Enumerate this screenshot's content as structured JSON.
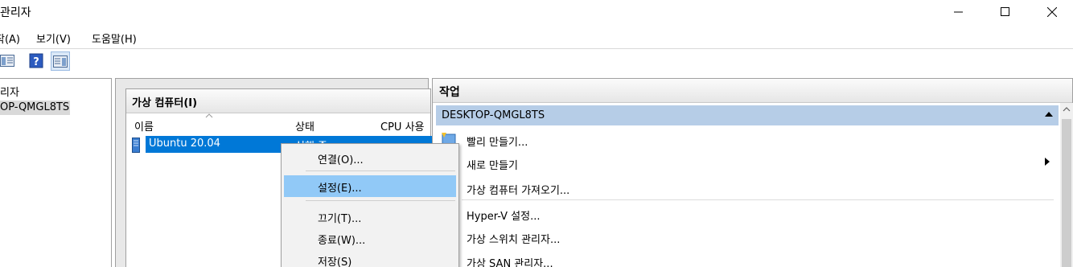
{
  "window": {
    "title": "관리자"
  },
  "menubar": {
    "items": [
      "작(A)",
      "보기(V)",
      "도움말(H)"
    ]
  },
  "toolbar": {
    "buttons": [
      "show-hide-tree-icon",
      "help-icon",
      "show-hide-action-pane-icon"
    ]
  },
  "tree": {
    "items": [
      "리자",
      "OP-QMGL8TS"
    ]
  },
  "vm_panel": {
    "title": "가상 컴퓨터(I)",
    "columns": [
      "이름",
      "상태",
      "CPU 사용"
    ],
    "rows": [
      {
        "name": "Ubuntu 20.04",
        "state": "실행 중"
      }
    ]
  },
  "context_menu": {
    "items": [
      "연결(O)...",
      "설정(E)...",
      "끄기(T)...",
      "종료(W)...",
      "저장(S)"
    ],
    "highlighted": "설정(E)..."
  },
  "actions": {
    "title": "작업",
    "section": "DESKTOP-QMGL8TS",
    "items": [
      "빨리 만들기...",
      "새로 만들기",
      "가상 컴퓨터 가져오기...",
      "Hyper-V 설정...",
      "가상 스위치 관리자...",
      "가상 SAN 관리자..."
    ]
  },
  "colors": {
    "selection": "#0078d7",
    "menu_highlight": "#91c9f7",
    "section_header": "#b6cde7"
  }
}
